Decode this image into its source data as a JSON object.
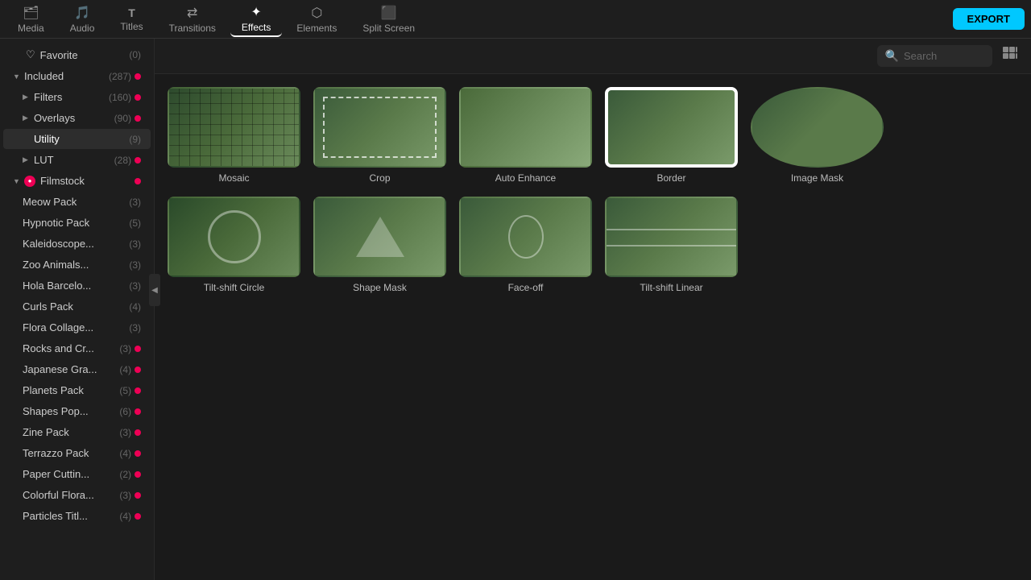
{
  "nav": {
    "items": [
      {
        "id": "media",
        "label": "Media",
        "icon": "🗂"
      },
      {
        "id": "audio",
        "label": "Audio",
        "icon": "🎵"
      },
      {
        "id": "titles",
        "label": "Titles",
        "icon": "T"
      },
      {
        "id": "transitions",
        "label": "Transitions",
        "icon": "↔"
      },
      {
        "id": "effects",
        "label": "Effects",
        "icon": "✨"
      },
      {
        "id": "elements",
        "label": "Elements",
        "icon": "⬡"
      },
      {
        "id": "split-screen",
        "label": "Split Screen",
        "icon": "⬛"
      }
    ],
    "active": "effects",
    "export_label": "EXPORT"
  },
  "sidebar": {
    "sections": [
      {
        "id": "favorite",
        "label": "Favorite",
        "count": "(0)",
        "icon": "♡",
        "expandable": false,
        "active": false,
        "red_dot": false
      },
      {
        "id": "included",
        "label": "Included",
        "count": "(287)",
        "expandable": true,
        "expanded": true,
        "active": false,
        "red_dot": true,
        "children": [
          {
            "id": "filters",
            "label": "Filters",
            "count": "(160)",
            "expandable": true,
            "red_dot": true
          },
          {
            "id": "overlays",
            "label": "Overlays",
            "count": "(90)",
            "expandable": true,
            "red_dot": true
          },
          {
            "id": "utility",
            "label": "Utility",
            "count": "(9)",
            "expandable": false,
            "active": true,
            "red_dot": false
          },
          {
            "id": "lut",
            "label": "LUT",
            "count": "(28)",
            "expandable": true,
            "red_dot": true
          }
        ]
      },
      {
        "id": "filmstock",
        "label": "Filmstock",
        "count": "",
        "expandable": true,
        "expanded": true,
        "active": false,
        "red_dot": true,
        "children": [
          {
            "id": "meow-pack",
            "label": "Meow Pack",
            "count": "(3)",
            "red_dot": false
          },
          {
            "id": "hypnotic-pack",
            "label": "Hypnotic Pack",
            "count": "(5)",
            "red_dot": false
          },
          {
            "id": "kaleidoscope",
            "label": "Kaleidoscope...",
            "count": "(3)",
            "red_dot": false
          },
          {
            "id": "zoo-animals",
            "label": "Zoo Animals...",
            "count": "(3)",
            "red_dot": false
          },
          {
            "id": "hola-barcelona",
            "label": "Hola Barcelo...",
            "count": "(3)",
            "red_dot": false
          },
          {
            "id": "curls-pack",
            "label": "Curls Pack",
            "count": "(4)",
            "red_dot": false
          },
          {
            "id": "flora-collage",
            "label": "Flora Collage...",
            "count": "(3)",
            "red_dot": false
          },
          {
            "id": "rocks-and-cr",
            "label": "Rocks and Cr...",
            "count": "(3)",
            "red_dot": true
          },
          {
            "id": "japanese-gra",
            "label": "Japanese Gra...",
            "count": "(4)",
            "red_dot": true
          },
          {
            "id": "planets-pack",
            "label": "Planets Pack",
            "count": "(5)",
            "red_dot": true
          },
          {
            "id": "shapes-pop",
            "label": "Shapes Pop...",
            "count": "(6)",
            "red_dot": true
          },
          {
            "id": "zine-pack",
            "label": "Zine Pack",
            "count": "(3)",
            "red_dot": true
          },
          {
            "id": "terrazzo-pack",
            "label": "Terrazzo Pack",
            "count": "(4)",
            "red_dot": true
          },
          {
            "id": "paper-cuttin",
            "label": "Paper Cuttin...",
            "count": "(2)",
            "red_dot": true
          },
          {
            "id": "colorful-flora",
            "label": "Colorful Flora...",
            "count": "(3)",
            "red_dot": true
          },
          {
            "id": "particles-titl",
            "label": "Particles Titl...",
            "count": "(4)",
            "red_dot": true
          }
        ]
      }
    ]
  },
  "content": {
    "search_placeholder": "Search",
    "effects": [
      {
        "id": "mosaic",
        "label": "Mosaic",
        "thumb_class": "thumb-mosaic",
        "selected": false
      },
      {
        "id": "crop",
        "label": "Crop",
        "thumb_class": "thumb-crop",
        "selected": false
      },
      {
        "id": "auto-enhance",
        "label": "Auto Enhance",
        "thumb_class": "thumb-auto-enhance",
        "selected": false
      },
      {
        "id": "border",
        "label": "Border",
        "thumb_class": "thumb-border",
        "selected": true
      },
      {
        "id": "image-mask",
        "label": "Image Mask",
        "thumb_class": "thumb-image-mask",
        "selected": false
      },
      {
        "id": "tilt-shift-circle",
        "label": "Tilt-shift Circle",
        "thumb_class": "thumb-tilt-shift-circle",
        "selected": false
      },
      {
        "id": "shape-mask",
        "label": "Shape Mask",
        "thumb_class": "thumb-shape-mask",
        "selected": false
      },
      {
        "id": "face-off",
        "label": "Face-off",
        "thumb_class": "thumb-face-off",
        "selected": false
      },
      {
        "id": "tilt-shift-linear",
        "label": "Tilt-shift Linear",
        "thumb_class": "thumb-tilt-shift-linear",
        "selected": false
      }
    ]
  }
}
